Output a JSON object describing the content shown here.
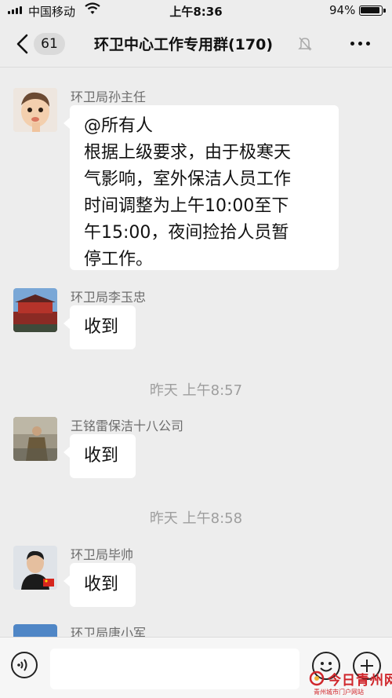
{
  "status_bar": {
    "carrier": "中国移动",
    "time": "上午8:36",
    "battery": "94%"
  },
  "nav": {
    "unread_badge": "61",
    "title": "环卫中心工作专用群(170)"
  },
  "messages": [
    {
      "sender": "环卫局孙主任",
      "lines": [
        "@所有人",
        "根据上级要求，由于极寒天",
        "气影响，室外保洁人员工作",
        "时间调整为上午10:00至下",
        "午15:00，夜间捡拾人员暂",
        "停工作。"
      ]
    },
    {
      "sender": "环卫局李玉忠",
      "lines": [
        "收到"
      ]
    },
    {
      "sender": "王铭雷保洁十八公司",
      "lines": [
        "收到"
      ]
    },
    {
      "sender": "环卫局毕帅",
      "lines": [
        "收到"
      ]
    },
    {
      "sender": "环卫局唐小军",
      "lines": []
    }
  ],
  "timestamps": [
    "昨天 上午8:57",
    "昨天 上午8:58"
  ],
  "input_bar": {
    "placeholder": "",
    "icons": [
      "voice-icon",
      "emoji-icon",
      "plus-icon"
    ]
  },
  "watermark": {
    "text": "今日青州网",
    "subtext": "青州城市门户网站"
  },
  "colors": {
    "background": "#ededed",
    "bubble": "#ffffff",
    "sender_text": "#6c6c6c",
    "timestamp_text": "#9e9e9e",
    "watermark": "#d0262b"
  }
}
